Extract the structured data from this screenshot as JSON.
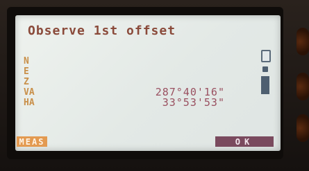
{
  "screen": {
    "title": "Observe 1st offset",
    "rows": [
      {
        "label": "N",
        "value": ""
      },
      {
        "label": "E",
        "value": ""
      },
      {
        "label": "Z",
        "value": ""
      },
      {
        "label": "VA",
        "value": "287°40'16\""
      },
      {
        "label": "HA",
        "value": "33°53'53\""
      }
    ],
    "softkeys": {
      "left": "MEAS",
      "right": "OK"
    }
  },
  "colors": {
    "title": "#8a4a3a",
    "label": "#c9904a",
    "value": "#9a5060",
    "meas_key": "#e39a51",
    "ok_key": "#7a4a5e"
  }
}
